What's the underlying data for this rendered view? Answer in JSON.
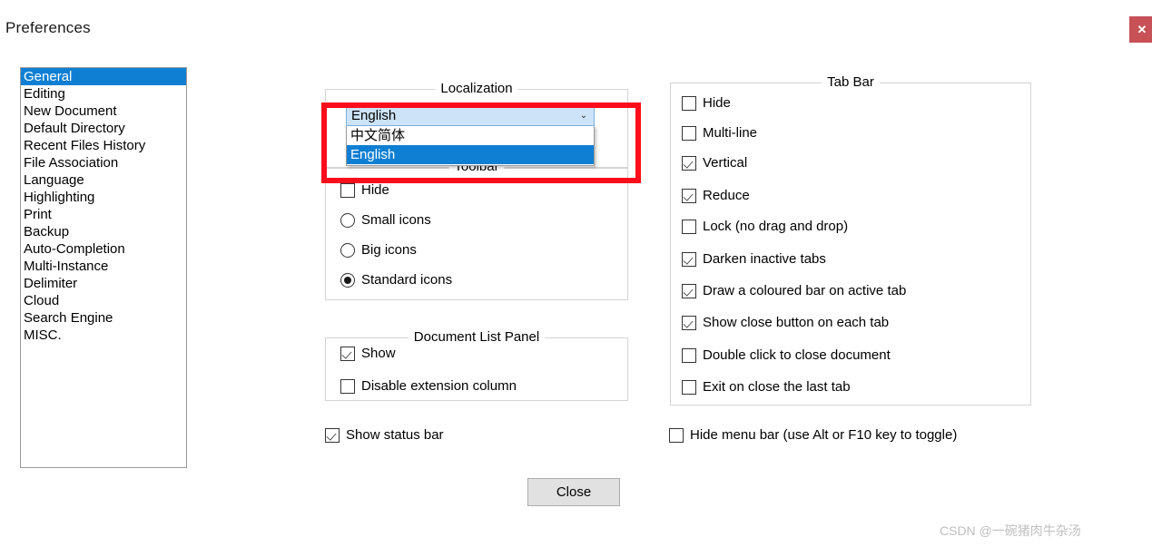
{
  "window": {
    "title": "Preferences",
    "close_icon": "close-icon",
    "close_glyph": "✕",
    "close_color": "#c75156"
  },
  "sidebar": {
    "items": [
      {
        "label": "General",
        "selected": true
      },
      {
        "label": "Editing",
        "selected": false
      },
      {
        "label": "New Document",
        "selected": false
      },
      {
        "label": "Default Directory",
        "selected": false
      },
      {
        "label": "Recent Files History",
        "selected": false
      },
      {
        "label": "File Association",
        "selected": false
      },
      {
        "label": "Language",
        "selected": false
      },
      {
        "label": "Highlighting",
        "selected": false
      },
      {
        "label": "Print",
        "selected": false
      },
      {
        "label": "Backup",
        "selected": false
      },
      {
        "label": "Auto-Completion",
        "selected": false
      },
      {
        "label": "Multi-Instance",
        "selected": false
      },
      {
        "label": "Delimiter",
        "selected": false
      },
      {
        "label": "Cloud",
        "selected": false
      },
      {
        "label": "Search Engine",
        "selected": false
      },
      {
        "label": "MISC.",
        "selected": false
      }
    ],
    "selection_color": "#0f7fd4"
  },
  "localization": {
    "group_title": "Localization",
    "selected_value": "English",
    "arrow_icon": "chevron-down-icon",
    "arrow_glyph": "⌄",
    "dropdown_open": true,
    "options": [
      {
        "label": "中文简体",
        "highlighted": false
      },
      {
        "label": "English",
        "highlighted": true
      }
    ]
  },
  "annotation": {
    "type": "red-rectangle-highlight",
    "color": "#fc0d1b"
  },
  "toolbar": {
    "group_title": "Toolbar",
    "hide": {
      "label": "Hide",
      "checked": false
    },
    "icon_size_options": [
      {
        "label": "Small icons",
        "selected": false
      },
      {
        "label": "Big icons",
        "selected": false
      },
      {
        "label": "Standard icons",
        "selected": true
      }
    ]
  },
  "document_list_panel": {
    "group_title": "Document List Panel",
    "options": [
      {
        "label": "Show",
        "checked": true
      },
      {
        "label": "Disable extension column",
        "checked": false
      }
    ]
  },
  "status_bar": {
    "label": "Show status bar",
    "checked": true
  },
  "tab_bar": {
    "group_title": "Tab Bar",
    "options": [
      {
        "label": "Hide",
        "checked": false
      },
      {
        "label": "Multi-line",
        "checked": false
      },
      {
        "label": "Vertical",
        "checked": true
      },
      {
        "label": "Reduce",
        "checked": true
      },
      {
        "label": "Lock (no drag and drop)",
        "checked": false
      },
      {
        "label": "Darken inactive tabs",
        "checked": true
      },
      {
        "label": "Draw a coloured bar on active tab",
        "checked": true
      },
      {
        "label": "Show close button on each tab",
        "checked": true
      },
      {
        "label": "Double click to close document",
        "checked": false
      },
      {
        "label": "Exit on close the last tab",
        "checked": false
      }
    ]
  },
  "menu_bar": {
    "label": "Hide menu bar (use Alt or F10 key to toggle)",
    "checked": false
  },
  "footer": {
    "close_label": "Close"
  },
  "watermark": {
    "text": "CSDN @一碗猪肉牛杂汤"
  }
}
